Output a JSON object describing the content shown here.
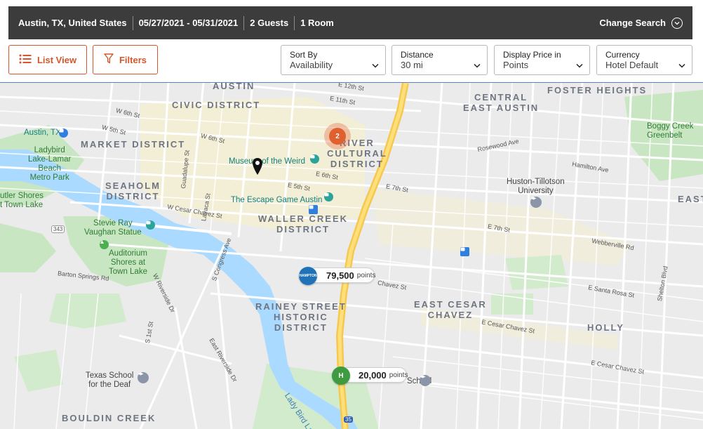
{
  "search_bar": {
    "location": "Austin, TX, United States",
    "dates": "05/27/2021 - 05/31/2021",
    "guests": "2 Guests",
    "rooms": "1 Room",
    "change_label": "Change Search"
  },
  "toolbar": {
    "list_view_label": "List View",
    "filters_label": "Filters",
    "dropdowns": [
      {
        "label": "Sort By",
        "value": "Availability"
      },
      {
        "label": "Distance",
        "value": "30 mi"
      },
      {
        "label": "Display Price in",
        "value": "Points"
      },
      {
        "label": "Currency",
        "value": "Hotel Default"
      }
    ]
  },
  "map": {
    "districts": {
      "austin": "AUSTIN",
      "civic": "CIVIC DISTRICT",
      "market": "MARKET DISTRICT",
      "seaholm": "SEAHOLM\nDISTRICT",
      "river_cultural": "RIVER\nCULTURAL\nDISTRICT",
      "waller": "WALLER CREEK\nDISTRICT",
      "central_east": "CENTRAL\nEAST AUSTIN",
      "foster": "FOSTER HEIGHTS",
      "rainey": "RAINEY STREET\nHISTORIC\nDISTRICT",
      "east_cesar": "EAST CESAR\nCHAVEZ",
      "holly": "HOLLY",
      "bouldin": "BOULDIN CREEK",
      "east": "EAST"
    },
    "pois": {
      "austin_tx": "Austin, TX",
      "ladybird": "Ladybird\nLake-Lamar\nBeach\nMetro Park",
      "butler": "utler Shores\nt Town Lake",
      "stevie": "Stevie Ray\nVaughan Statue",
      "auditorium": "Auditorium\nShores at\nTown Lake",
      "museum": "Museum of the Weird",
      "escape": "The Escape Game Austin",
      "huston": "Huston-Tillotson\nUniversity",
      "boggy": "Boggy Creek\nGreenbelt",
      "texas_school": "Texas School\nfor the Deaf",
      "lady_bird_lake": "Lady Bird Lake",
      "school": "School"
    },
    "streets": {
      "w6th": "W 6th St",
      "w5th": "W 5th St",
      "w6th_b": "W 6th St",
      "w_cesar": "W Cesar Chavez St",
      "e11th": "E 11th St",
      "e12th": "E 12th St",
      "e6th": "E 6th St",
      "e5th": "E 5th St",
      "e7th": "E 7th St",
      "e7th_b": "E 7th St",
      "chavez": "Chavez St",
      "e_cesar": "E Cesar Chavez St",
      "e_cesar_b": "E Cesar Chavez St",
      "barton": "Barton Springs Rd",
      "riverside": "W Riverside Dr",
      "s_congress": "S Congress Ave",
      "east_riverside": "East Riverside Dr",
      "s1st": "S 1st St",
      "guadalupe": "Guadalupe St",
      "lavaca": "Lavaca St",
      "rosewood": "Rosewood Ave",
      "webberville": "Webberville Rd",
      "hamilton": "Hamilton Ave",
      "santa_rosa": "E Santa Rosa St",
      "shelton": "Shelton Blvd",
      "hwy343": "343",
      "i35": "35"
    },
    "cluster_count": "2",
    "hotels": [
      {
        "brand": "HAMPTON",
        "points": "79,500",
        "unit": "points",
        "color": "#1f72b8"
      },
      {
        "brand": "H",
        "points": "20,000",
        "unit": "points",
        "color": "#3f9b3f"
      }
    ]
  }
}
